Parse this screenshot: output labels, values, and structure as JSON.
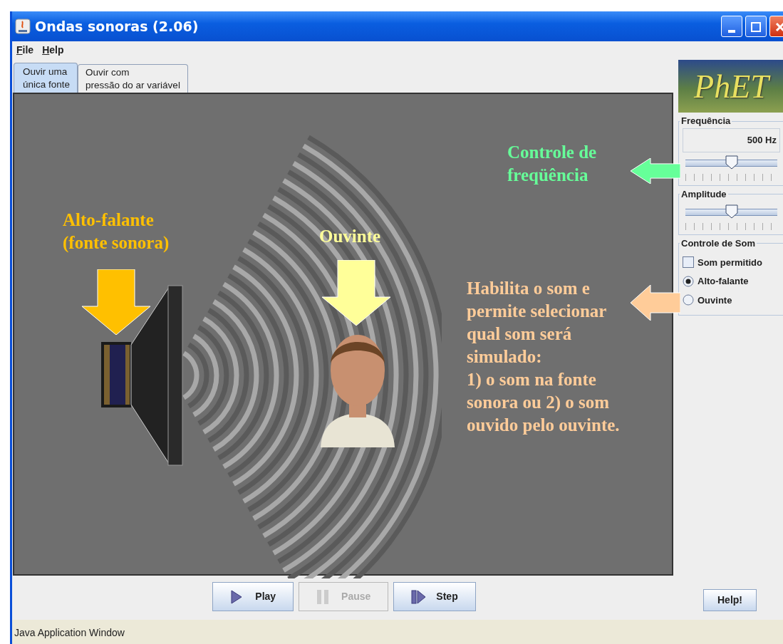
{
  "window": {
    "title": "Ondas sonoras (2.06)"
  },
  "menu": [
    {
      "label": "File"
    },
    {
      "label": "Help"
    }
  ],
  "tabs": [
    {
      "label": "Ouvir uma\núnica fonte",
      "selected": true
    },
    {
      "label": "Ouvir com\npressão do ar variável",
      "selected": false
    }
  ],
  "annotations": [
    {
      "text": "Alto-falante\n(fonte sonora)",
      "color": "#ffc000",
      "kind": "down"
    },
    {
      "text": "Ouvinte",
      "color": "#ffff99",
      "kind": "down"
    },
    {
      "text": "Controle de\nfreqüência",
      "color": "#66ff99",
      "kind": "left"
    },
    {
      "text": "Habilita o som e\npermite selecionar\nqual som será\nsimulado:\n1) o som na fonte\nsonora ou 2) o som\nouvido pelo ouvinte.",
      "color": "#ffcc99",
      "kind": "left"
    }
  ],
  "logo": {
    "text": "PhET"
  },
  "frequency": {
    "title": "Frequência",
    "reading": "500 Hz",
    "level": 0.5
  },
  "amplitude": {
    "title": "Amplitude",
    "level": 0.5
  },
  "sound_control": {
    "title": "Controle de Som",
    "options": [
      {
        "kind": "checkbox",
        "label": "Som permitido",
        "checked": false
      },
      {
        "kind": "radio",
        "label": "Alto-falante",
        "selected": true
      },
      {
        "kind": "radio",
        "label": "Ouvinte",
        "selected": false
      }
    ]
  },
  "controls": [
    {
      "kind": "play",
      "label": "Play",
      "disabled": false
    },
    {
      "kind": "pause",
      "label": "Pause",
      "disabled": true
    },
    {
      "kind": "step",
      "label": "Step",
      "disabled": false
    }
  ],
  "help_button": {
    "label": "Help!"
  },
  "status_bar": {
    "text": "Java Application Window"
  }
}
